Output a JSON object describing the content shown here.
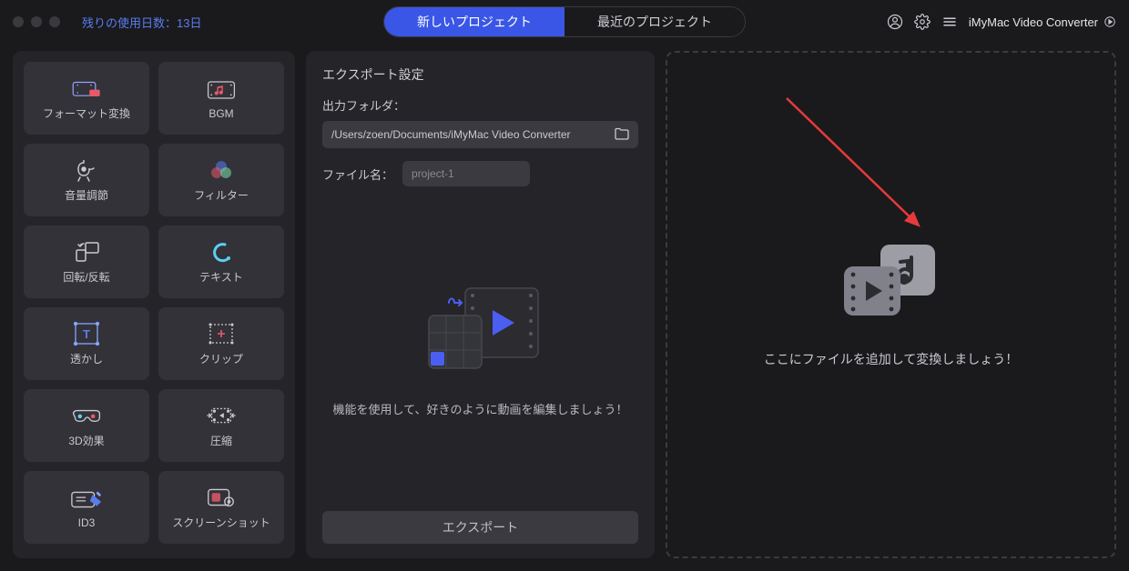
{
  "titlebar": {
    "trial_label": "残りの使用日数：13日",
    "tab_new": "新しいプロジェクト",
    "tab_recent": "最近のプロジェクト",
    "app_name": "iMyMac Video Converter"
  },
  "tools": [
    {
      "id": "format-convert",
      "label": "フォーマット変換"
    },
    {
      "id": "bgm",
      "label": "BGM"
    },
    {
      "id": "volume",
      "label": "音量調節"
    },
    {
      "id": "filter",
      "label": "フィルター"
    },
    {
      "id": "rotate",
      "label": "回転/反転"
    },
    {
      "id": "text",
      "label": "テキスト"
    },
    {
      "id": "watermark",
      "label": "透かし"
    },
    {
      "id": "clip",
      "label": "クリップ"
    },
    {
      "id": "3d",
      "label": "3D効果"
    },
    {
      "id": "compress",
      "label": "圧縮"
    },
    {
      "id": "id3",
      "label": "ID3"
    },
    {
      "id": "screenshot",
      "label": "スクリーンショット"
    }
  ],
  "export": {
    "title": "エクスポート設定",
    "folder_label": "出力フォルダ：",
    "folder_path": "/Users/zoen/Documents/iMyMac Video Converter",
    "filename_label": "ファイル名：",
    "filename_value": "project-1",
    "editor_hint": "機能を使用して、好きのように動画を編集しましょう！",
    "button_label": "エクスポート"
  },
  "dropzone": {
    "hint": "ここにファイルを追加して変換しましょう！"
  },
  "colors": {
    "accent": "#3a56e6",
    "panel": "#252529",
    "bg": "#1a1a1d"
  }
}
